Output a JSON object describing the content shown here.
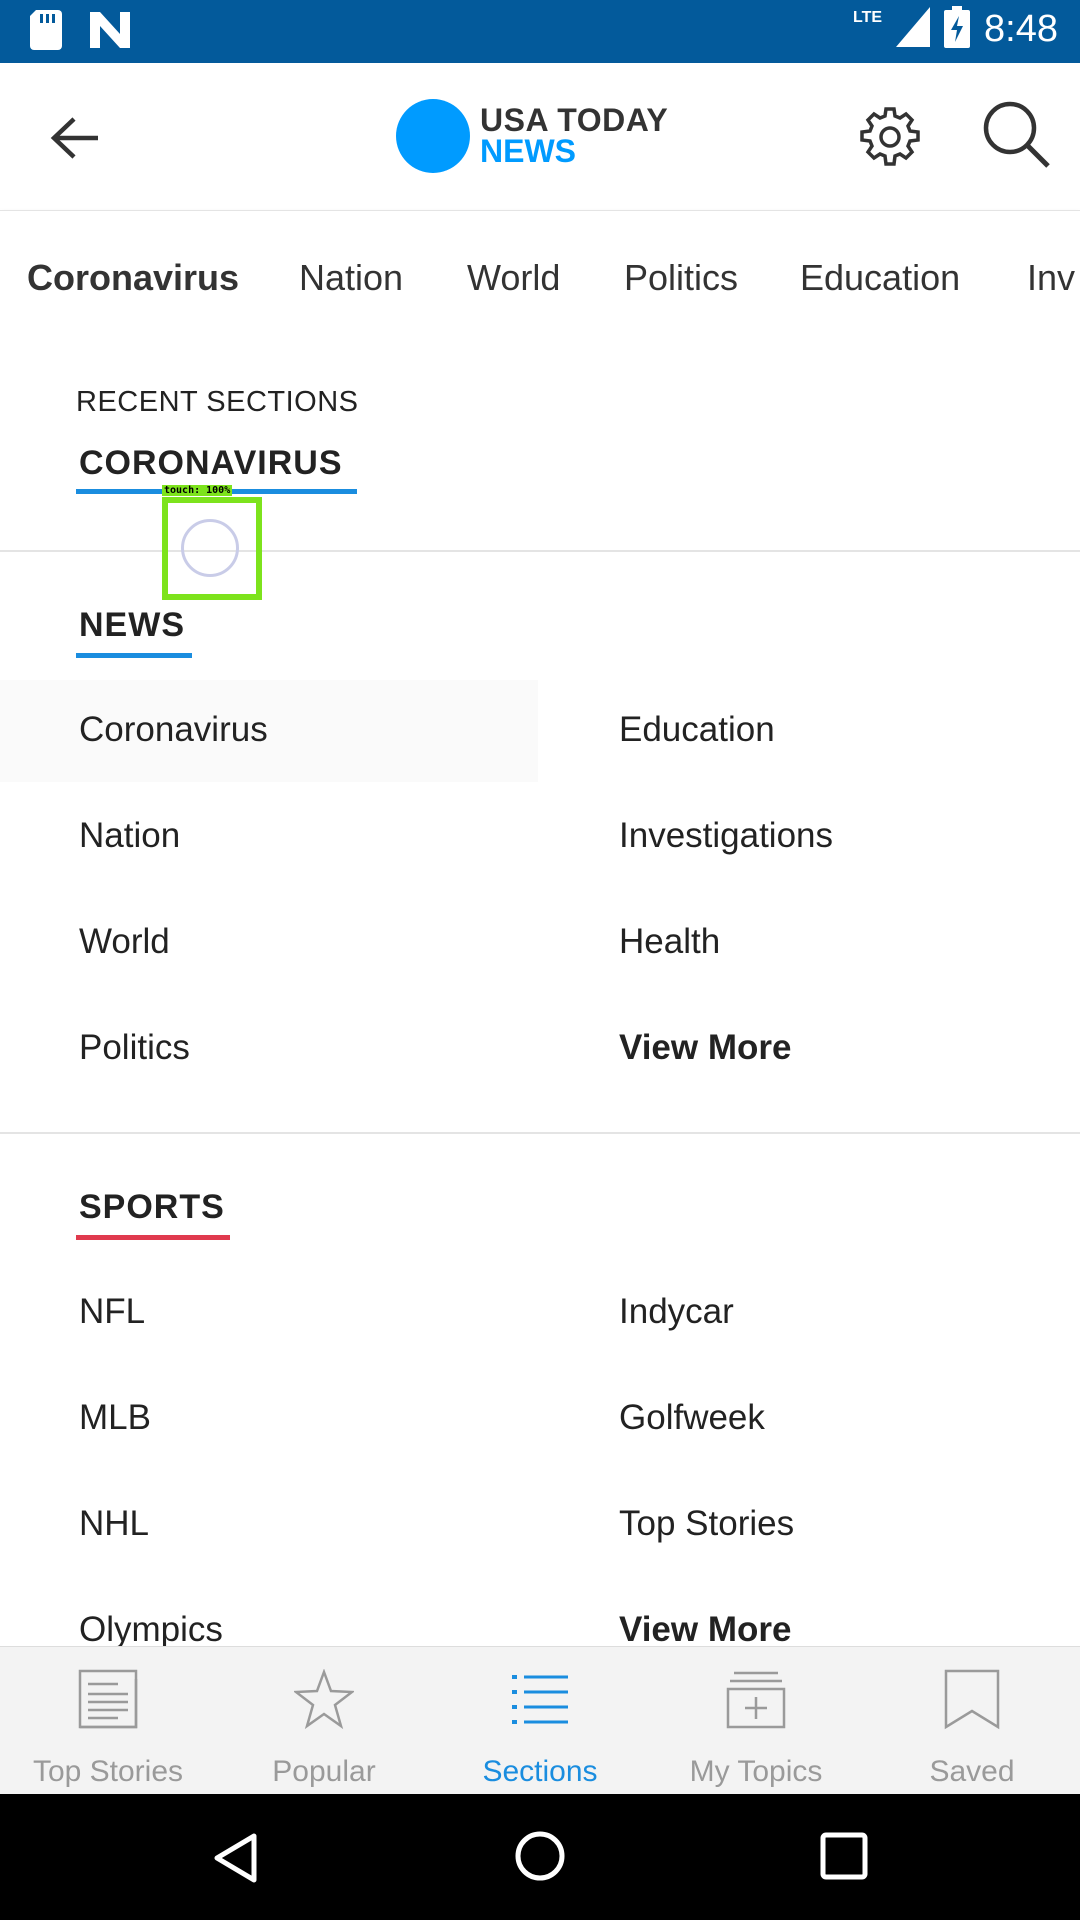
{
  "status_bar": {
    "time": "8:48",
    "network": "LTE",
    "left_icons": [
      "sd-card-icon",
      "n-notification-icon"
    ]
  },
  "header": {
    "logo_line1": "USA TODAY",
    "logo_line2": "NEWS",
    "brand_color": "#009bff",
    "icons": [
      "back-arrow-icon",
      "gear-icon",
      "search-icon"
    ]
  },
  "tabs": [
    {
      "label": "Coronavirus",
      "active": true
    },
    {
      "label": "Nation"
    },
    {
      "label": "World"
    },
    {
      "label": "Politics"
    },
    {
      "label": "Education"
    },
    {
      "label": "Inv"
    }
  ],
  "recent": {
    "label": "RECENT SECTIONS",
    "items": [
      "CORONAVIRUS"
    ],
    "underline_color": "#1a8ddf"
  },
  "touch_overlay": {
    "label": "touch: 100%"
  },
  "news": {
    "title": "NEWS",
    "underline_color": "#1a8ddf",
    "left": [
      "Coronavirus",
      "Nation",
      "World",
      "Politics"
    ],
    "right": [
      "Education",
      "Investigations",
      "Health",
      "View More"
    ]
  },
  "sports": {
    "title": "SPORTS",
    "underline_color": "#e03a4e",
    "left": [
      "NFL",
      "MLB",
      "NHL",
      "Olympics"
    ],
    "right": [
      "Indycar",
      "Golfweek",
      "Top Stories",
      "View More"
    ]
  },
  "bottom_nav": [
    {
      "label": "Top Stories",
      "icon": "newspaper-icon"
    },
    {
      "label": "Popular",
      "icon": "star-icon"
    },
    {
      "label": "Sections",
      "icon": "list-icon",
      "active": true
    },
    {
      "label": "My Topics",
      "icon": "add-topic-icon"
    },
    {
      "label": "Saved",
      "icon": "bookmark-icon"
    }
  ],
  "android_nav": [
    "back-triangle-icon",
    "home-circle-icon",
    "recents-square-icon"
  ]
}
